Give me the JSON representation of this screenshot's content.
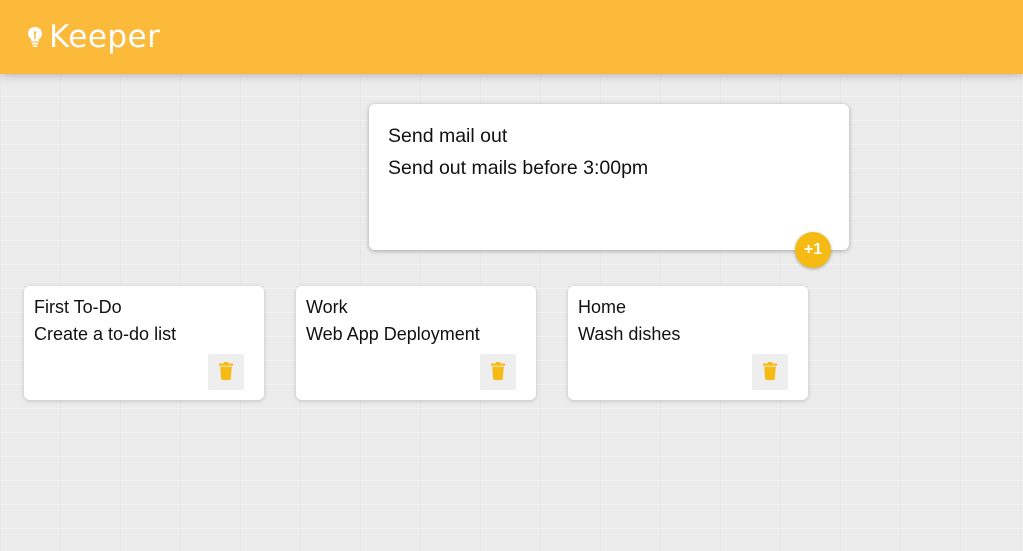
{
  "app": {
    "title": "Keeper",
    "logo_icon": "lightbulb-icon",
    "brand_color": "#fbba3a",
    "accent_color": "#f5ba13"
  },
  "composer": {
    "title_value": "Send mail out",
    "content_value": "Send out mails before 3:00pm",
    "add_button_label": "+1"
  },
  "notes": [
    {
      "title": "First To-Do",
      "content": "Create a to-do list",
      "delete_icon": "trash-icon"
    },
    {
      "title": "Work",
      "content": "Web App Deployment",
      "delete_icon": "trash-icon"
    },
    {
      "title": "Home",
      "content": "Wash dishes",
      "delete_icon": "trash-icon"
    }
  ]
}
